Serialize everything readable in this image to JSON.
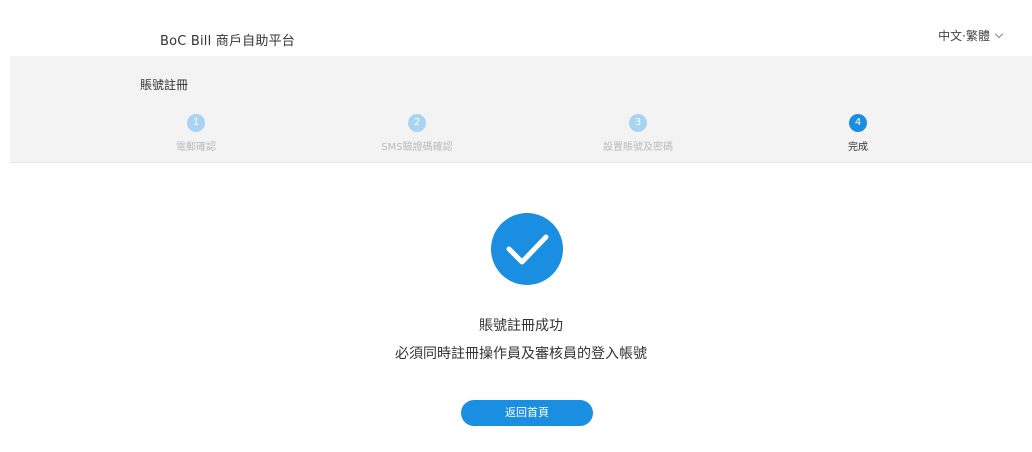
{
  "header": {
    "brand": "BoC Bill 商戶自助平台",
    "language": "中文·繁體"
  },
  "registration": {
    "section_title": "賬號註冊",
    "steps": [
      {
        "number": "1",
        "label": "電郵確認",
        "state": "inactive"
      },
      {
        "number": "2",
        "label": "SMS驗證碼確認",
        "state": "inactive"
      },
      {
        "number": "3",
        "label": "設置賬號及密碼",
        "state": "inactive"
      },
      {
        "number": "4",
        "label": "完成",
        "state": "active"
      }
    ],
    "current_step": 4
  },
  "result": {
    "icon": "check-circle-icon",
    "title": "賬號註冊成功",
    "subtitle": "必須同時註冊操作員及審核員的登入帳號",
    "home_button": "返回首頁"
  },
  "colors": {
    "accent": "#1a8ee0",
    "accent_light": "#a9d3f3",
    "panel_bg": "#f3f3f3"
  }
}
